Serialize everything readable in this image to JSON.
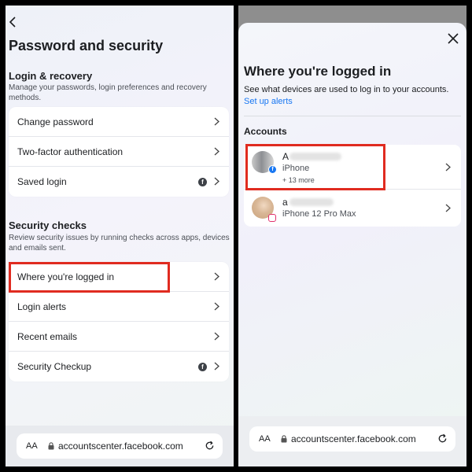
{
  "left": {
    "page_title": "Password and security",
    "login_section": {
      "title": "Login & recovery",
      "description": "Manage your passwords, login preferences and recovery methods.",
      "items": [
        {
          "label": "Change password",
          "icon": null
        },
        {
          "label": "Two-factor authentication",
          "icon": null
        },
        {
          "label": "Saved login",
          "icon": "facebook-icon"
        }
      ]
    },
    "security_section": {
      "title": "Security checks",
      "description": "Review security issues by running checks across apps, devices and emails sent.",
      "items": [
        {
          "label": "Where you're logged in",
          "icon": null
        },
        {
          "label": "Login alerts",
          "icon": null
        },
        {
          "label": "Recent emails",
          "icon": null
        },
        {
          "label": "Security Checkup",
          "icon": "facebook-icon"
        }
      ]
    },
    "browser": {
      "aa": "AA",
      "url": "accountscenter.facebook.com"
    }
  },
  "right": {
    "title": "Where you're logged in",
    "description": "See what devices are used to log in to your accounts.",
    "link": "Set up alerts",
    "accounts_heading": "Accounts",
    "accounts": [
      {
        "name": "A",
        "device": "iPhone",
        "more": "+ 13 more",
        "app": "facebook"
      },
      {
        "name": "a",
        "device": "iPhone 12 Pro Max",
        "more": "",
        "app": "instagram"
      }
    ],
    "browser": {
      "aa": "AA",
      "url": "accountscenter.facebook.com"
    }
  },
  "colors": {
    "highlight": "#e02b20",
    "link": "#1877f2",
    "facebook": "#1877f2",
    "instagram": "#e1306c"
  }
}
